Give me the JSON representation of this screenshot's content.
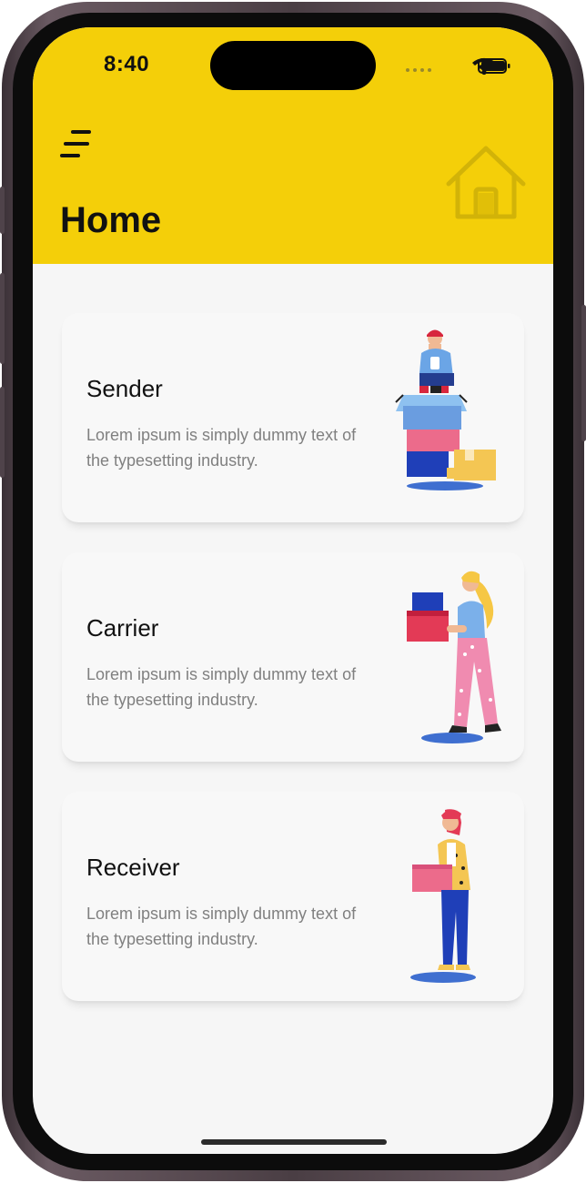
{
  "status_bar": {
    "time": "8:40"
  },
  "header": {
    "title": "Home"
  },
  "cards": [
    {
      "title": "Sender",
      "description": "Lorem ipsum is simply dummy text of the typesetting industry."
    },
    {
      "title": "Carrier",
      "description": "Lorem ipsum is simply dummy text of the typesetting industry."
    },
    {
      "title": "Receiver",
      "description": "Lorem ipsum is simply dummy text of the typesetting industry."
    }
  ],
  "icons": {
    "menu": "menu-icon",
    "home": "home-icon",
    "wifi": "wifi-icon",
    "battery": "battery-icon",
    "signal": "signal-icon"
  },
  "colors": {
    "header": "#f4cf09",
    "background": "#f6f6f6",
    "title_text": "#111111",
    "description_text": "#808080"
  }
}
